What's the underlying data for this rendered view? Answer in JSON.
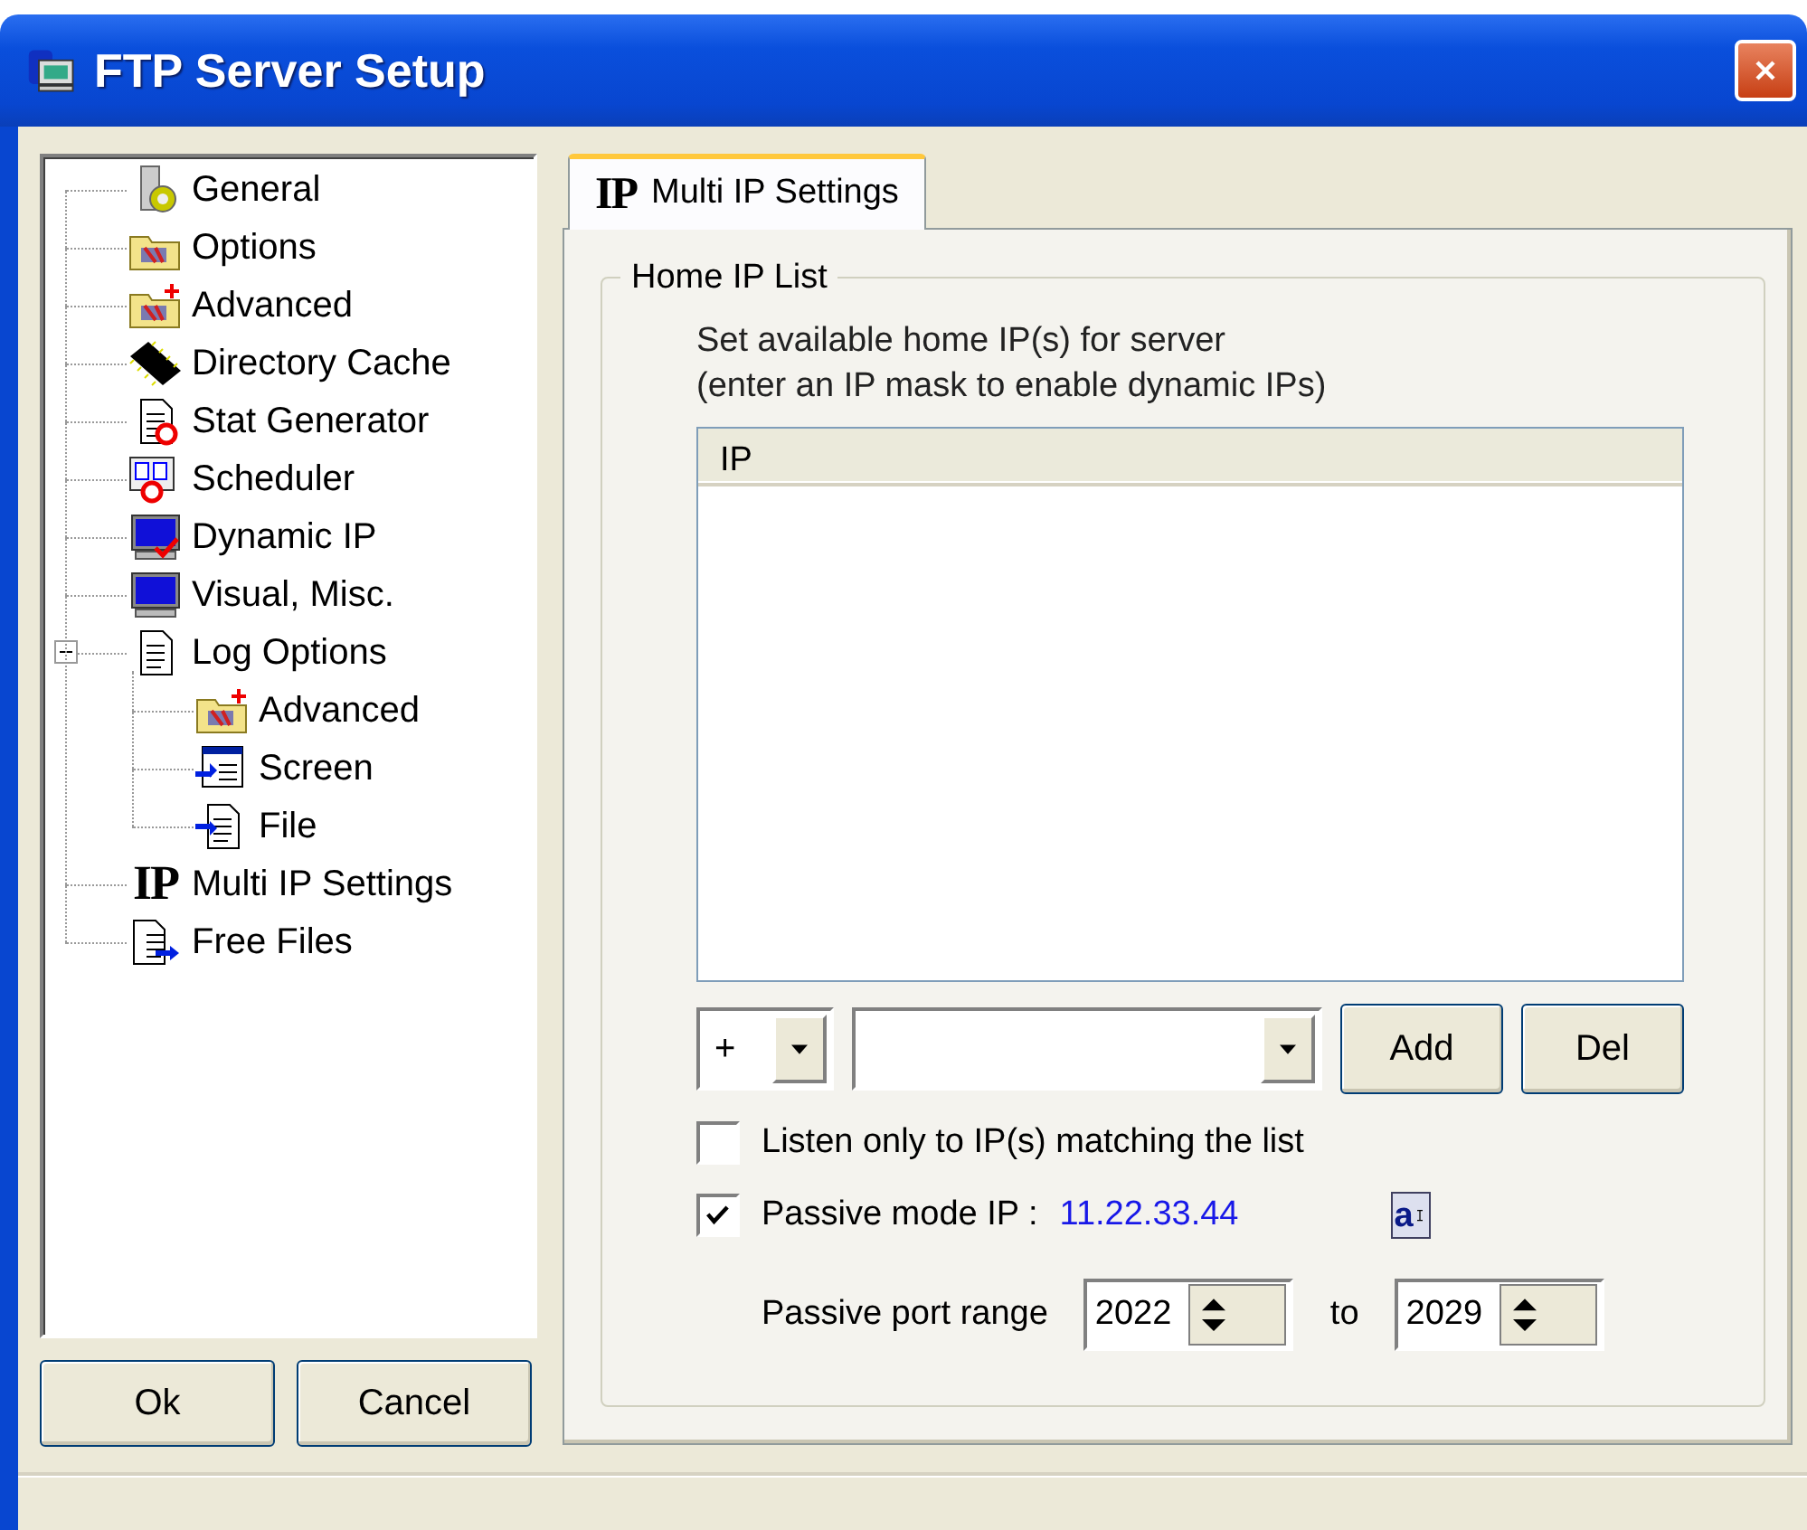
{
  "window": {
    "title": "FTP Server Setup"
  },
  "tree": [
    {
      "label": "General"
    },
    {
      "label": "Options"
    },
    {
      "label": "Advanced"
    },
    {
      "label": "Directory Cache"
    },
    {
      "label": "Stat Generator"
    },
    {
      "label": "Scheduler"
    },
    {
      "label": "Dynamic IP"
    },
    {
      "label": "Visual, Misc."
    },
    {
      "label": "Log Options",
      "expanded": true,
      "children": [
        {
          "label": "Advanced"
        },
        {
          "label": "Screen"
        },
        {
          "label": "File"
        }
      ]
    },
    {
      "label": "Multi IP Settings",
      "glyph": "IP"
    },
    {
      "label": "Free Files"
    }
  ],
  "buttons": [
    {
      "label": "Ok"
    },
    {
      "label": "Cancel"
    }
  ],
  "tabs": [
    {
      "label": "Multi IP Settings",
      "glyph": "IP",
      "selected": true
    }
  ],
  "group": {
    "title": "Home IP List",
    "description": [
      "Set available home IP(s) for server",
      "(enter an IP mask to enable dynamic IPs)"
    ],
    "list": {
      "columns": [
        "IP"
      ]
    },
    "sign_combo": {
      "value": "+"
    },
    "actions": [
      {
        "label": "Add"
      },
      {
        "label": "Del"
      }
    ],
    "checkboxes": [
      {
        "label": "Listen only to IP(s) matching the list",
        "checked": false
      },
      {
        "label": "Passive mode IP :",
        "checked": true,
        "value": "11.22.33.44",
        "edit_button": "a"
      }
    ],
    "port_range": {
      "label": "Passive port range",
      "from": "2022",
      "separator": "to",
      "to": "2029"
    }
  }
}
